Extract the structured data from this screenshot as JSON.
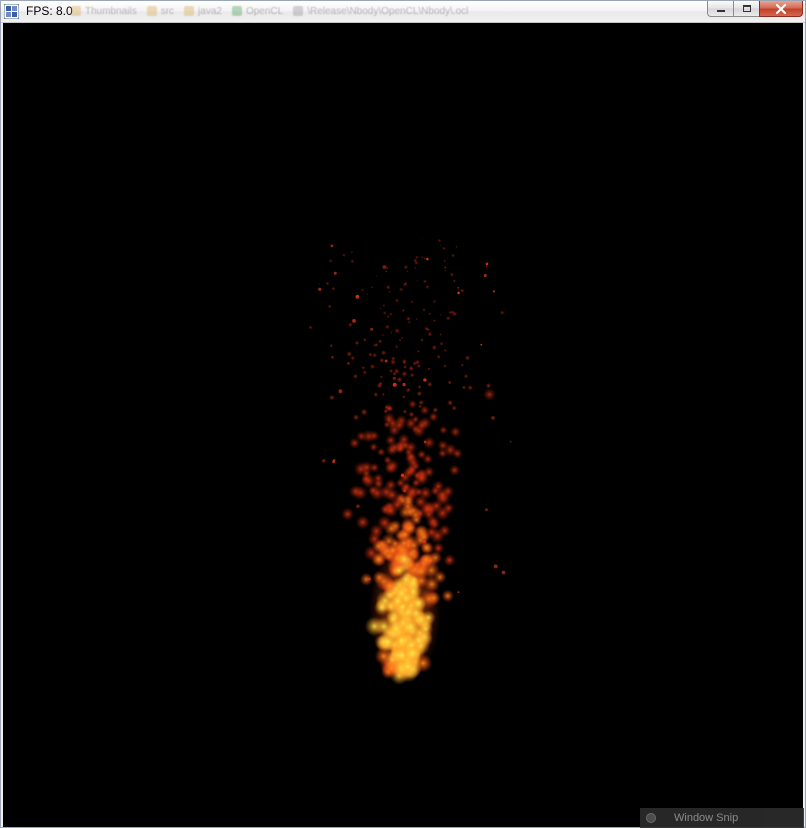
{
  "window": {
    "title": "FPS: 8.0",
    "icon": "app-window-icon"
  },
  "background_taskbar": {
    "tabs": [
      {
        "label": "Thumbnails",
        "icon": "folder-icon",
        "color": "#d9a441"
      },
      {
        "label": "src",
        "icon": "folder-icon",
        "color": "#d9a441"
      },
      {
        "label": "java2",
        "icon": "folder-icon",
        "color": "#d9a441"
      },
      {
        "label": "OpenCL",
        "icon": "opencl-icon",
        "color": "#3c9a4a"
      },
      {
        "label": "\\Release\\Nbody\\OpenCL\\Nbody\\.ocl",
        "icon": "file-icon",
        "color": "#8a8a8a"
      }
    ]
  },
  "caption_buttons": {
    "minimize": "minimize-icon",
    "maximize": "maximize-icon",
    "close": "close-icon"
  },
  "render": {
    "background": "#000000",
    "colors": {
      "core": "#ffe84a",
      "mid": "#ff8a1a",
      "outer": "#e83a14",
      "dim": "#8a1c0a"
    }
  },
  "overlay": {
    "snip_label": "Window Snip",
    "snip_icon": "snip-icon"
  }
}
